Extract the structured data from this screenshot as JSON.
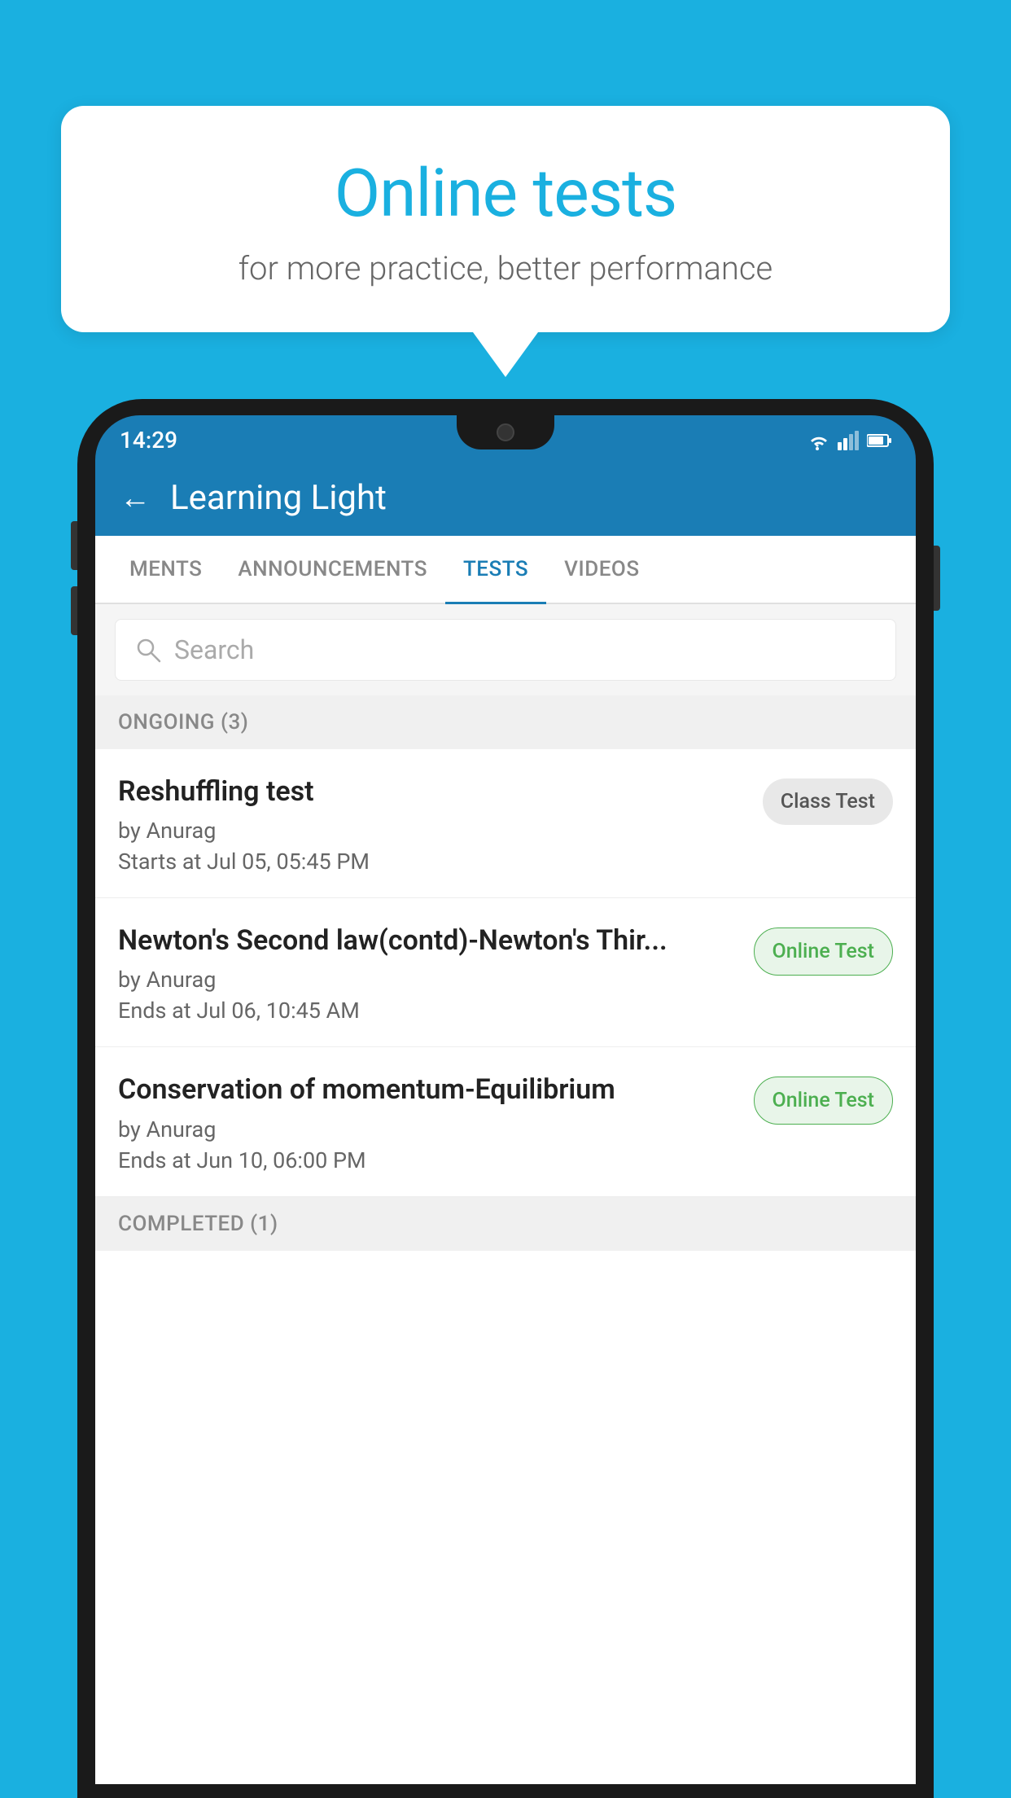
{
  "background": {
    "color": "#1ab0e0"
  },
  "speech_bubble": {
    "title": "Online tests",
    "subtitle": "for more practice, better performance"
  },
  "phone": {
    "status_bar": {
      "time": "14:29",
      "icons": [
        "wifi",
        "signal",
        "battery"
      ]
    },
    "header": {
      "back_label": "←",
      "title": "Learning Light"
    },
    "tabs": [
      {
        "label": "MENTS",
        "active": false
      },
      {
        "label": "ANNOUNCEMENTS",
        "active": false
      },
      {
        "label": "TESTS",
        "active": true
      },
      {
        "label": "VIDEOS",
        "active": false
      }
    ],
    "search": {
      "placeholder": "Search"
    },
    "sections": [
      {
        "header": "ONGOING (3)",
        "items": [
          {
            "title": "Reshuffling test",
            "author": "by Anurag",
            "date": "Starts at  Jul 05, 05:45 PM",
            "badge": "Class Test",
            "badge_type": "class"
          },
          {
            "title": "Newton's Second law(contd)-Newton's Thir...",
            "author": "by Anurag",
            "date": "Ends at  Jul 06, 10:45 AM",
            "badge": "Online Test",
            "badge_type": "online"
          },
          {
            "title": "Conservation of momentum-Equilibrium",
            "author": "by Anurag",
            "date": "Ends at  Jun 10, 06:00 PM",
            "badge": "Online Test",
            "badge_type": "online"
          }
        ]
      },
      {
        "header": "COMPLETED (1)",
        "items": []
      }
    ]
  }
}
